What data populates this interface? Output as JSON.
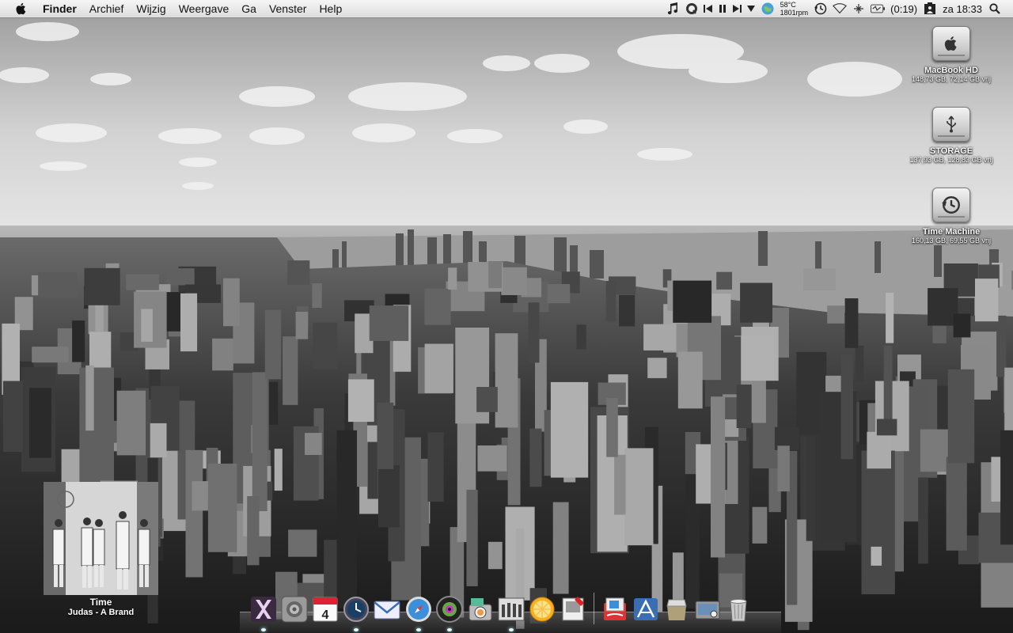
{
  "menubar": {
    "app_name": "Finder",
    "menus": [
      "Archief",
      "Wijzig",
      "Weergave",
      "Ga",
      "Venster",
      "Help"
    ],
    "status": {
      "temperature": "58°C",
      "fan_speed": "1801rpm",
      "battery_time": "(0:19)",
      "clock": "za 18:33"
    }
  },
  "desktop_icons": [
    {
      "name": "MacBook HD",
      "info": "148,73 GB, 72,14 GB vrij",
      "icon": "hard-drive-icon"
    },
    {
      "name": "STORAGE",
      "info": "137,93 GB, 128,83 GB vrij",
      "icon": "usb-drive-icon"
    },
    {
      "name": "Time Machine",
      "info": "160,13 GB, 69,55 GB vrij",
      "icon": "time-machine-drive-icon"
    }
  ],
  "now_playing": {
    "title": "Time",
    "artist_line": "Judas  - A Brand"
  },
  "dock": {
    "calendar_day": "4",
    "items": [
      "Mac OS X",
      "System Preferences",
      "iCal",
      "Time Machine",
      "Mail",
      "Safari",
      "iTunes",
      "iPhoto",
      "Album",
      "Lemon",
      "Preview",
      "Documents",
      "Applications",
      "Downloads",
      "Stack",
      "Trash"
    ]
  },
  "colors": {
    "menubar_bg": "#e8e8e8",
    "sky": "#c9c9c9",
    "water": "#8f8f8f"
  }
}
